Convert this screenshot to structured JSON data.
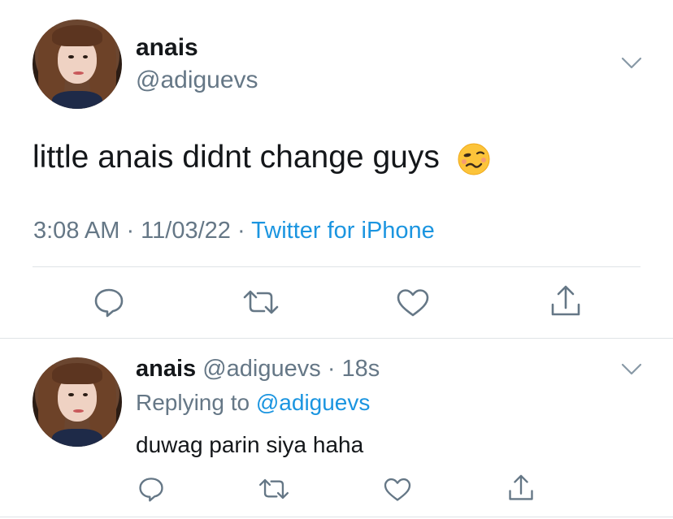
{
  "main_tweet": {
    "author_name": "anais",
    "author_handle": "@adiguevs",
    "text": "little anais didnt change guys",
    "emoji": "woozy-face",
    "timestamp": "3:08 AM · 11/03/22 · ",
    "source": "Twitter for iPhone"
  },
  "reply_tweet": {
    "author_name": "anais",
    "author_handle": "@adiguevs",
    "time_ago": "· 18s",
    "replying_label": "Replying to ",
    "replying_mention": "@adiguevs",
    "text": "duwag parin siya haha"
  },
  "colors": {
    "text": "#14171a",
    "secondary": "#657786",
    "accent": "#1b95e0",
    "divider": "#dfe3e6"
  }
}
